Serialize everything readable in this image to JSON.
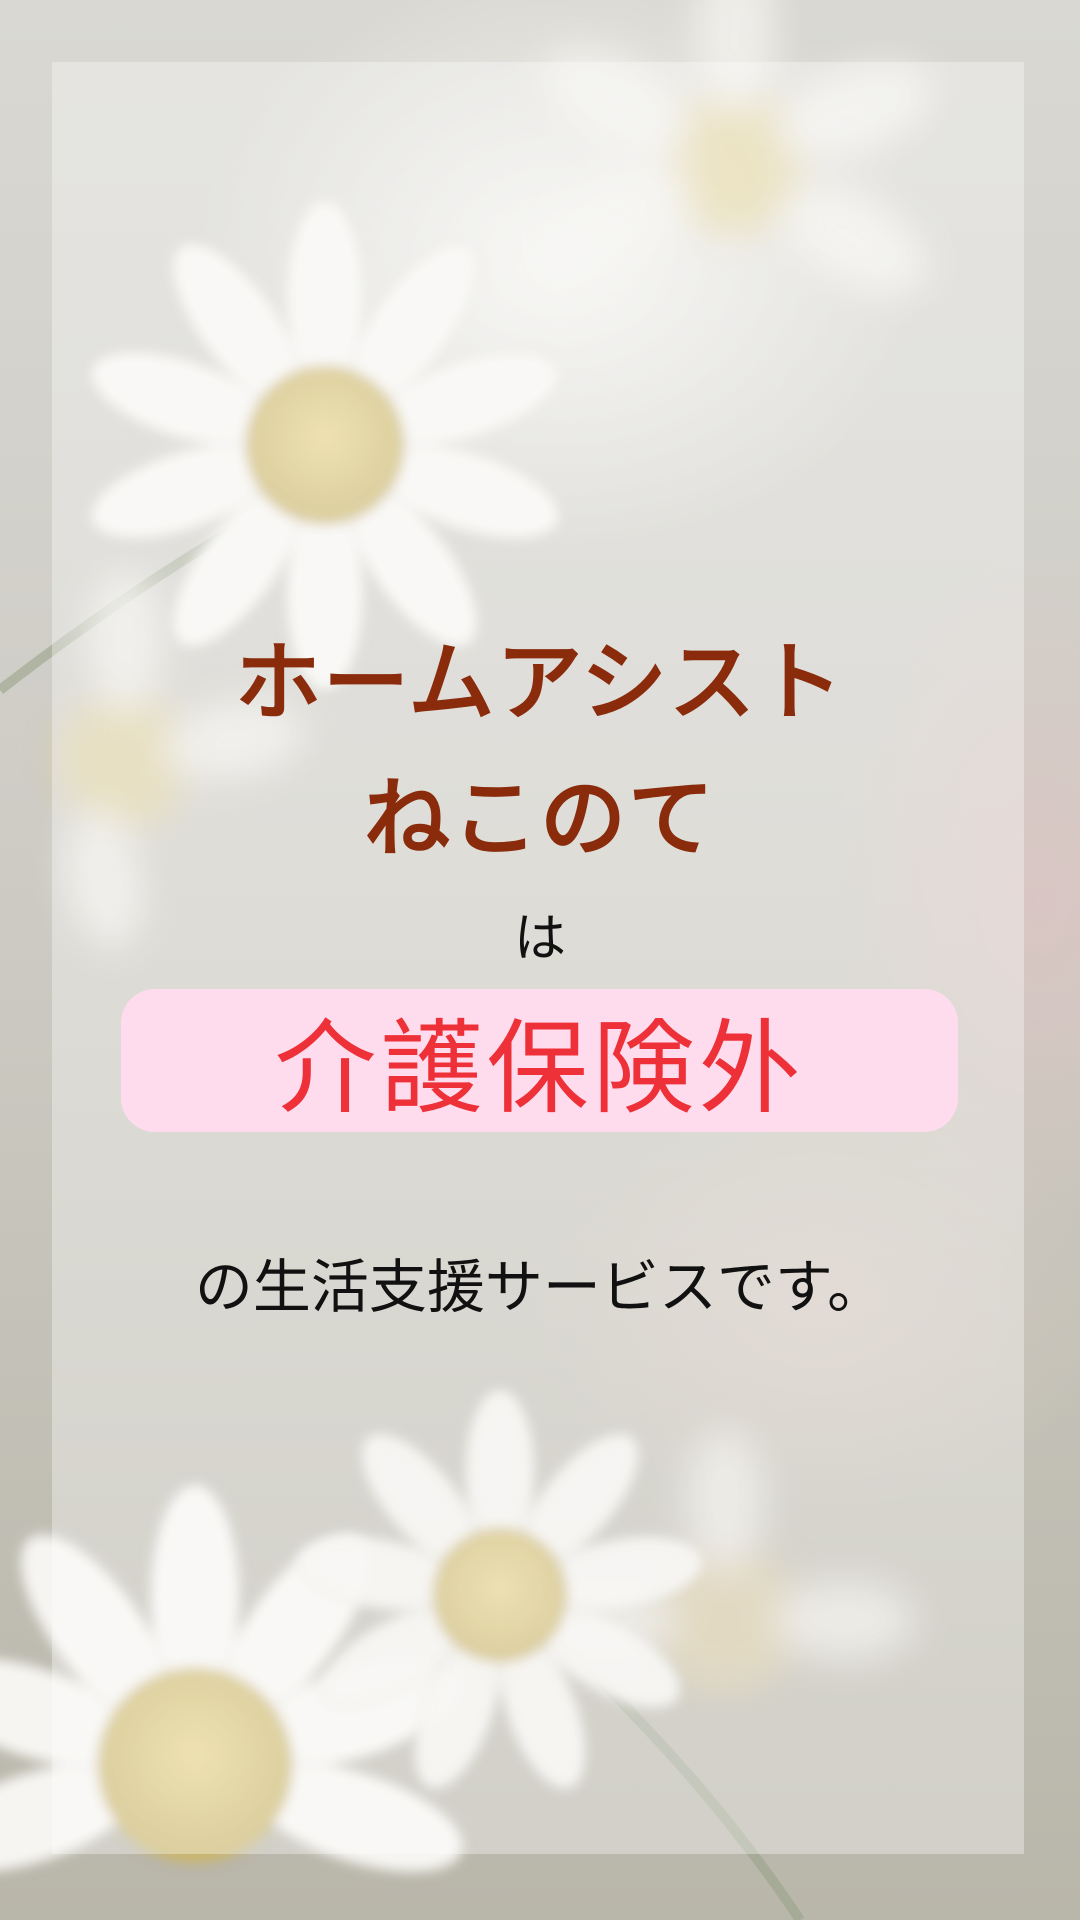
{
  "title": {
    "line1": "ホームアシスト",
    "line2": "ねこのて"
  },
  "particle": "は",
  "highlight": {
    "text": "介護保険外",
    "background": "#ffdced",
    "text_color": "#ee3138"
  },
  "tail": "の生活支援サービスです。",
  "colors": {
    "title": "#8a2c0c",
    "body": "#111111"
  },
  "background_image": "white chamomile daisy flowers"
}
